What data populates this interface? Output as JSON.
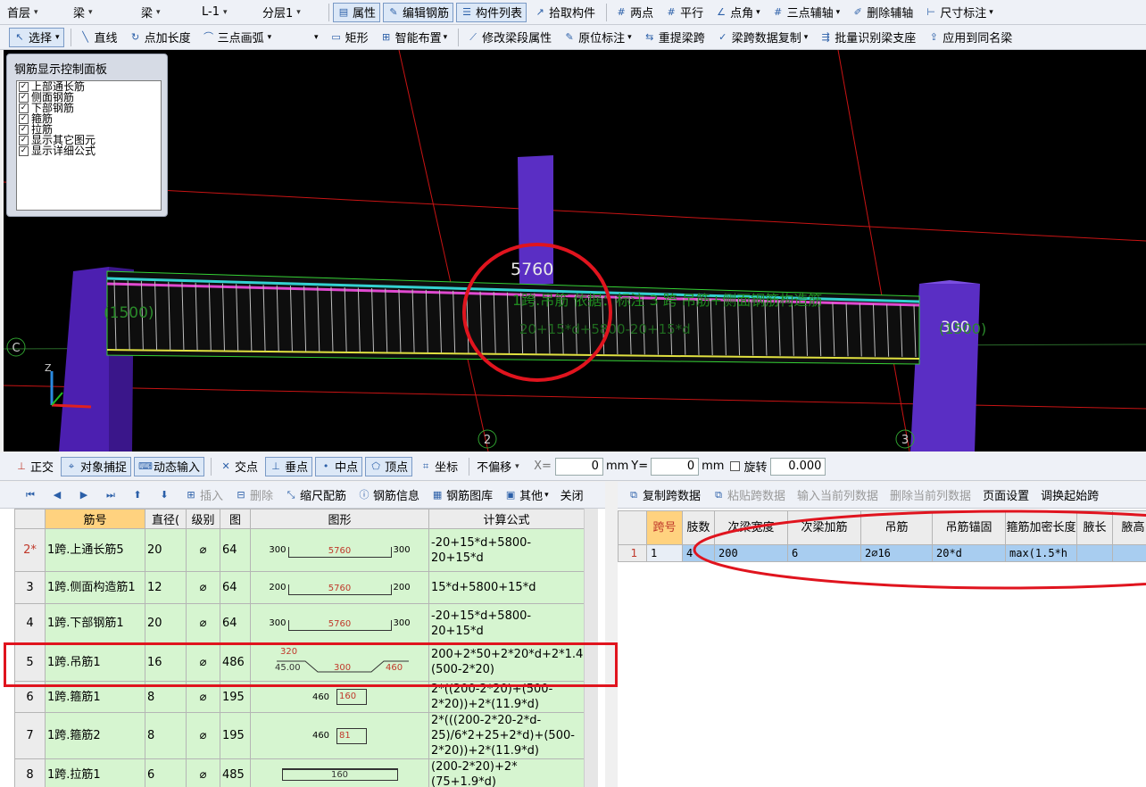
{
  "toolbar1": {
    "dropdowns": [
      "首层",
      "梁",
      "梁",
      "L-1",
      "分层1"
    ],
    "buttons": [
      "属性",
      "编辑钢筋",
      "构件列表",
      "拾取构件",
      "两点",
      "平行",
      "点角",
      "三点辅轴",
      "删除辅轴",
      "尺寸标注"
    ]
  },
  "toolbar2": {
    "buttons": [
      "选择",
      "直线",
      "点加长度",
      "三点画弧",
      "矩形",
      "智能布置",
      "修改梁段属性",
      "原位标注",
      "重提梁跨",
      "梁跨数据复制",
      "批量识别梁支座",
      "应用到同名梁"
    ]
  },
  "control_panel": {
    "title": "钢筋显示控制面板",
    "items": [
      "上部通长筋",
      "侧面钢筋",
      "下部钢筋",
      "箍筋",
      "拉筋",
      "显示其它图元",
      "显示详细公式"
    ]
  },
  "viewport": {
    "dim_label": "5760",
    "left_label": "(1500)",
    "right_label": "300",
    "right_label2": "(1500)",
    "axis_c": "C",
    "axis_2": "2",
    "axis_3": "3",
    "annot_line1": "1跨.吊筋 依据：标注 3 跨 吊筋+侧面钢筋构造筋",
    "annot_line2": "20+15*d+5800-20+15*d"
  },
  "snap_toolbar": {
    "items": [
      "正交",
      "对象捕捉",
      "动态输入",
      "交点",
      "垂点",
      "中点",
      "顶点",
      "坐标"
    ],
    "offset_select": "不偏移",
    "x_label": "X=",
    "x_value": "0",
    "unit1": "mm",
    "y_label": "Y=",
    "y_value": "0",
    "unit2": "mm",
    "rotate_label": "旋转",
    "rotate_value": "0.000"
  },
  "rebar_toolbar": {
    "items": [
      "插入",
      "删除",
      "缩尺配筋",
      "钢筋信息",
      "钢筋图库",
      "其他",
      "关闭"
    ]
  },
  "rebar_table": {
    "headers": [
      "",
      "筋号",
      "直径(",
      "级别",
      "图",
      "图形",
      "计算公式"
    ],
    "rows": [
      {
        "no": "2*",
        "name": "1跨.上通长筋5",
        "dia": "20",
        "grade": "⌀",
        "fig": "64",
        "shape": {
          "l": "300",
          "m": "5760",
          "r": "300"
        },
        "formula": "-20+15*d+5800-20+15*d"
      },
      {
        "no": "3",
        "name": "1跨.侧面构造筋1",
        "dia": "12",
        "grade": "⌀",
        "fig": "64",
        "shape": {
          "l": "200",
          "m": "5760",
          "r": "200"
        },
        "formula": "15*d+5800+15*d"
      },
      {
        "no": "4",
        "name": "1跨.下部钢筋1",
        "dia": "20",
        "grade": "⌀",
        "fig": "64",
        "shape": {
          "l": "300",
          "m": "5760",
          "r": "300"
        },
        "formula": "-20+15*d+5800-20+15*d"
      },
      {
        "no": "5",
        "name": "1跨.吊筋1",
        "dia": "16",
        "grade": "⌀",
        "fig": "486",
        "shape": {
          "top": "320",
          "ang": "45.00",
          "m": "300",
          "r": "460"
        },
        "formula": "200+2*50+2*20*d+2*1.414*(500-2*20)"
      },
      {
        "no": "6",
        "name": "1跨.箍筋1",
        "dia": "8",
        "grade": "⌀",
        "fig": "195",
        "shape": {
          "l": "460",
          "m": "160"
        },
        "formula": "2*((200-2*20)+(500-2*20))+2*(11.9*d)"
      },
      {
        "no": "7",
        "name": "1跨.箍筋2",
        "dia": "8",
        "grade": "⌀",
        "fig": "195",
        "shape": {
          "l": "460",
          "m": "81"
        },
        "formula": "2*(((200-2*20-2*d-25)/6*2+25+2*d)+(500-2*20))+2*(11.9*d)"
      },
      {
        "no": "8",
        "name": "1跨.拉筋1",
        "dia": "6",
        "grade": "⌀",
        "fig": "485",
        "shape": {
          "m": "160"
        },
        "formula": "(200-2*20)+2*(75+1.9*d)"
      }
    ]
  },
  "span_toolbar": {
    "items": [
      "复制跨数据",
      "粘贴跨数据",
      "输入当前列数据",
      "删除当前列数据",
      "页面设置",
      "调换起始跨"
    ]
  },
  "span_table": {
    "headers": [
      "",
      "跨号",
      "肢数",
      "次梁宽度",
      "次梁加筋",
      "吊筋",
      "吊筋锚固",
      "箍筋加密长度",
      "腋长",
      "腋高"
    ],
    "rows": [
      {
        "rn": "1",
        "span": "1",
        "legs": "4",
        "width": "200",
        "add": "6",
        "hanger": "2⌀16",
        "anchor": "20*d",
        "dense": "max(1.5*h"
      }
    ]
  },
  "colors": {
    "accent": "#e0141e",
    "grid_green": "#d6f5d0",
    "selected_row": "#a8cdf0",
    "column_purple": "#5a2ec4"
  }
}
